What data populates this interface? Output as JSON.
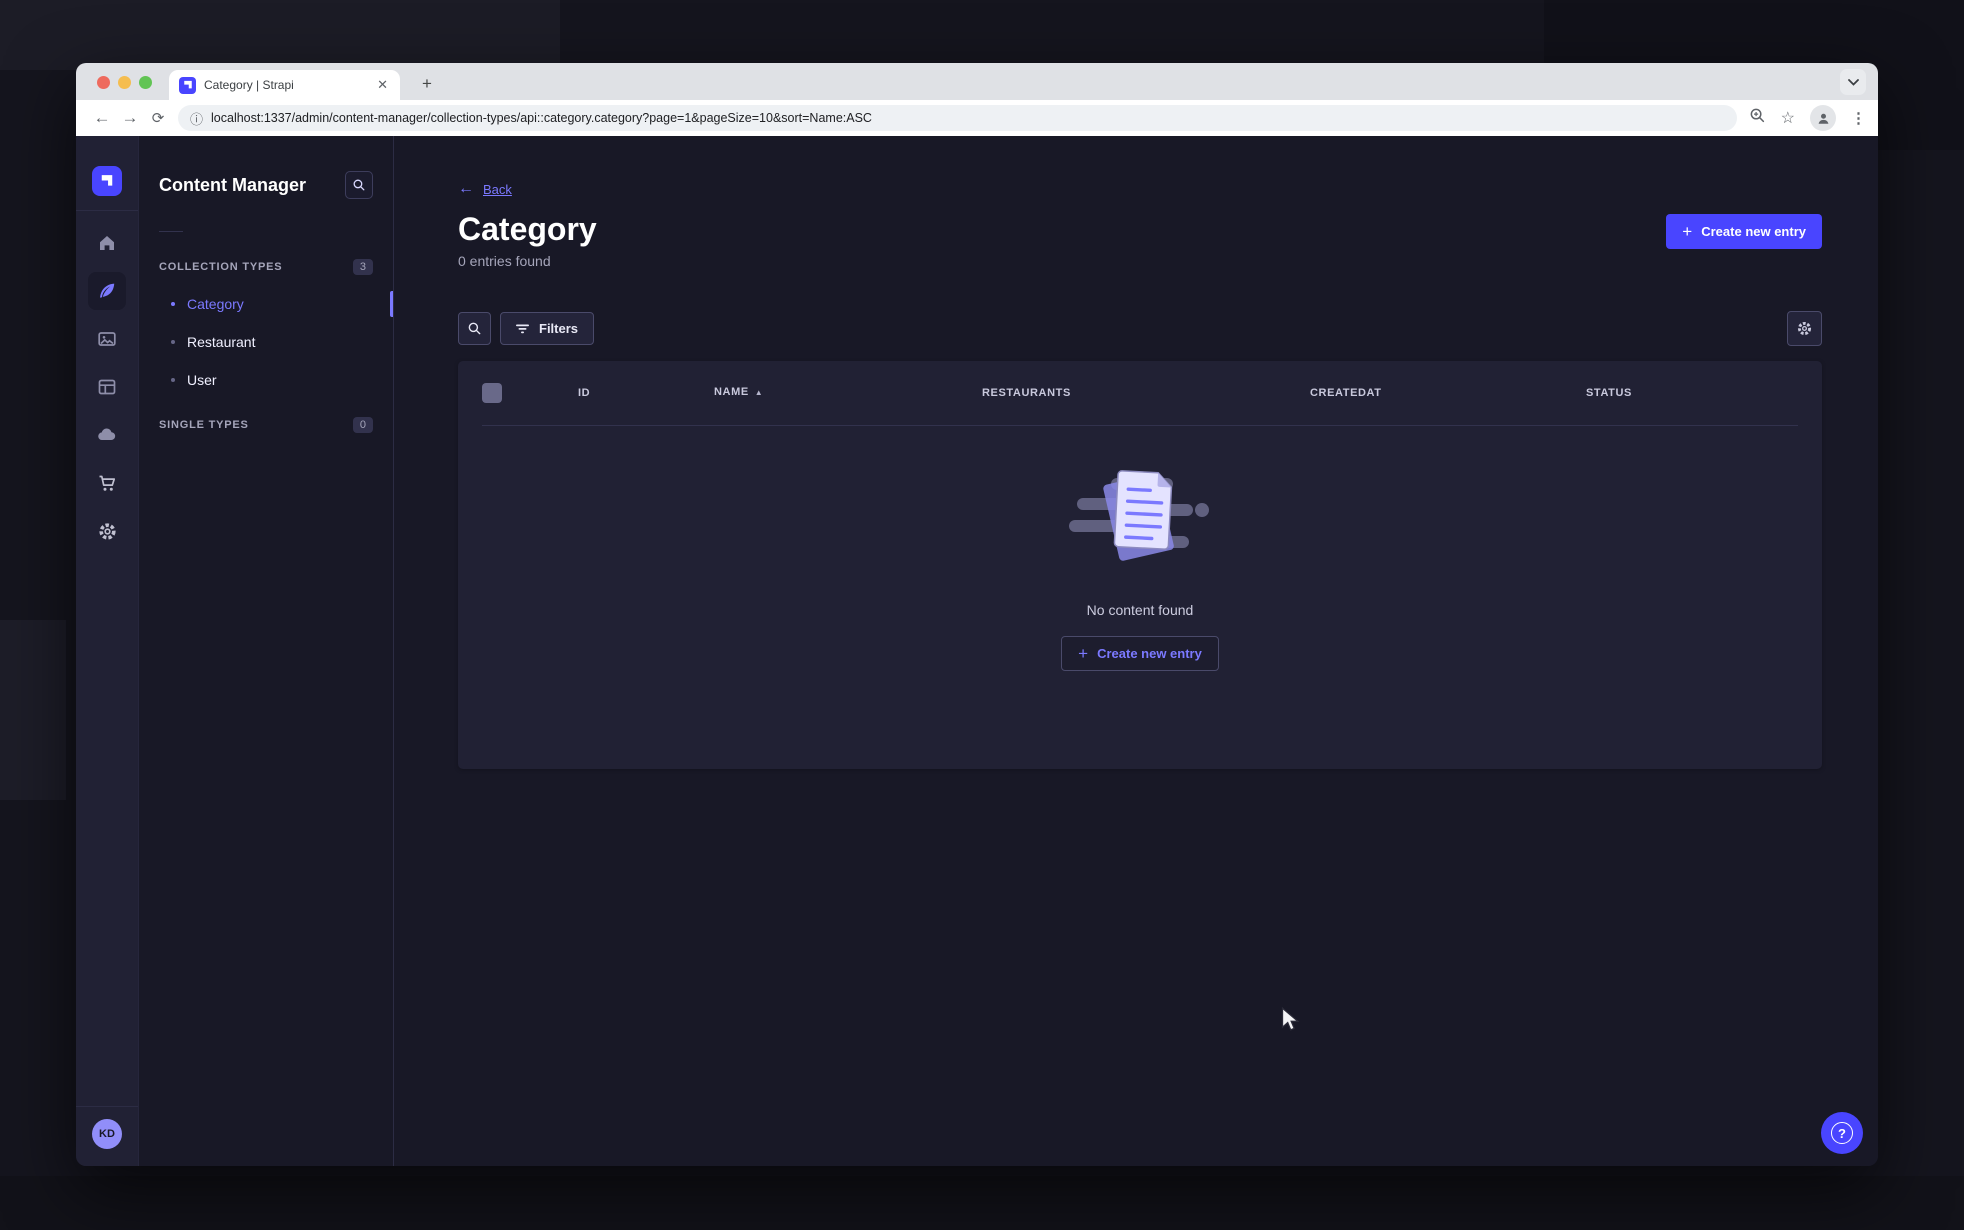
{
  "browser": {
    "tab_title": "Category | Strapi",
    "url": "localhost:1337/admin/content-manager/collection-types/api::category.category?page=1&pageSize=10&sort=Name:ASC"
  },
  "subnav": {
    "title": "Content Manager",
    "collection_types": {
      "label": "COLLECTION TYPES",
      "badge": "3",
      "items": [
        {
          "label": "Category",
          "active": true
        },
        {
          "label": "Restaurant",
          "active": false
        },
        {
          "label": "User",
          "active": false
        }
      ]
    },
    "single_types": {
      "label": "SINGLE TYPES",
      "badge": "0"
    }
  },
  "main": {
    "back_label": "Back",
    "title": "Category",
    "subtitle": "0 entries found",
    "create_button_label": "Create new entry",
    "filters_label": "Filters"
  },
  "table": {
    "columns": [
      "ID",
      "NAME",
      "RESTAURANTS",
      "CREATEDAT",
      "STATUS"
    ],
    "sorted_column": "NAME",
    "sort_direction": "ASC",
    "empty_message": "No content found",
    "empty_create_label": "Create new entry"
  },
  "user": {
    "initials": "KD"
  },
  "colors": {
    "accent": "#4945ff",
    "accent_light": "#7b79ff",
    "surface": "#212134",
    "background": "#181826"
  }
}
